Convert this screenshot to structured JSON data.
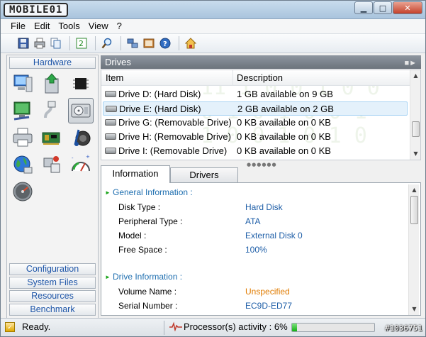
{
  "window": {
    "logo_text": "MOBILE01",
    "buttons": {
      "minimize": "▁",
      "maximize": "□",
      "close": "✕"
    }
  },
  "menu": [
    "File",
    "Edit",
    "Tools",
    "View",
    "?"
  ],
  "toolbar_icons": [
    "save-icon",
    "print-icon",
    "copy-icon",
    "refresh-icon",
    "search-icon",
    "network-icon",
    "report-icon",
    "help-icon",
    "home-icon"
  ],
  "sidebar": {
    "hardware_label": "Hardware",
    "hardware_icons": [
      "computer-icon",
      "motherboard-icon",
      "chip-icon",
      "display-icon",
      "usb-icon",
      "drives-icon",
      "printer-icon",
      "network-card-icon",
      "sound-icon",
      "internet-icon",
      "plugins-icon",
      "gauge-icon",
      "speedometer-icon"
    ],
    "groups": [
      "Configuration",
      "System Files",
      "Resources",
      "Benchmark"
    ]
  },
  "drives": {
    "title": "Drives",
    "columns": {
      "item": "Item",
      "description": "Description"
    },
    "rows": [
      {
        "name": "Drive D: (Hard Disk)",
        "desc": "1 GB available on 9 GB"
      },
      {
        "name": "Drive E: (Hard Disk)",
        "desc": "2 GB available on 2 GB"
      },
      {
        "name": "Drive G: (Removable Drive)",
        "desc": "0 KB available on 0 KB"
      },
      {
        "name": "Drive H: (Removable Drive)",
        "desc": "0 KB available on 0 KB"
      },
      {
        "name": "Drive I: (Removable Drive)",
        "desc": "0 KB available on 0 KB"
      }
    ],
    "selected_index": 1
  },
  "tabs": {
    "information": "Information",
    "drivers": "Drivers"
  },
  "info": {
    "general_title": "General Information :",
    "general": [
      {
        "key": "Disk Type :",
        "value": "Hard Disk"
      },
      {
        "key": "Peripheral Type :",
        "value": "ATA"
      },
      {
        "key": "Model :",
        "value": "External Disk 0"
      },
      {
        "key": "Free Space :",
        "value": "100%"
      }
    ],
    "drive_title": "Drive Information :",
    "drive": [
      {
        "key": "Volume Name :",
        "value": "Unspecified"
      },
      {
        "key": "Serial Number :",
        "value": "EC9D-ED77"
      }
    ]
  },
  "status": {
    "ready": "Ready.",
    "processor": "Processor(s) activity : 6%",
    "cpu_activity": 0.06
  },
  "watermark": "#1036751"
}
